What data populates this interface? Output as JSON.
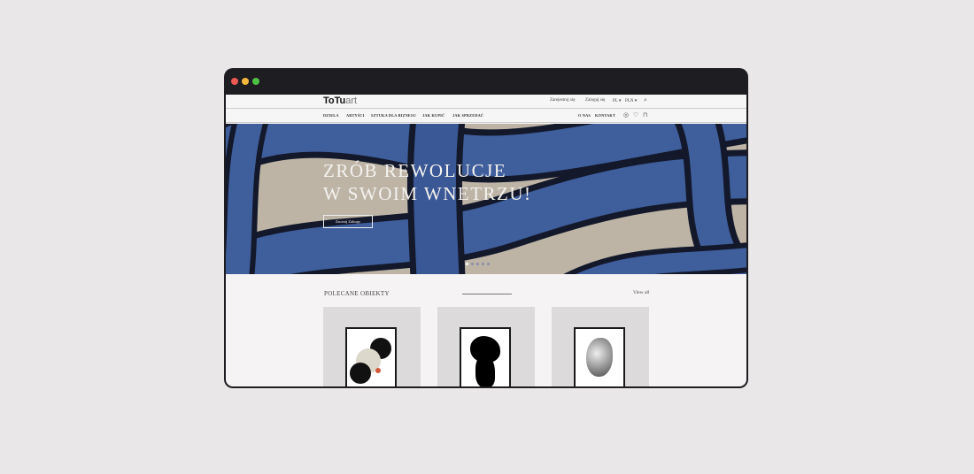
{
  "header": {
    "logo_bold": "ToTu",
    "logo_light": "art",
    "register": "Zarejestruj się",
    "login": "Zaloguj się",
    "language": "PL ▾",
    "currency": "PLN ▾"
  },
  "nav": {
    "items": [
      "DZIEŁA",
      "ARTYŚCI",
      "SZTUKA DLA BIZNESU",
      "JAK KUPIĆ",
      "JAK SPRZEDAĆ"
    ],
    "right": [
      "O NAS",
      "KONTAKT"
    ]
  },
  "hero": {
    "title_line1": "ZRÓB REWOLUCJE",
    "title_line2": "W SWOIM WNETRZU!",
    "button": "Zacznij Zakupy",
    "slides": 5,
    "active_slide": 1
  },
  "featured": {
    "title": "POLECANE OBIEKTY",
    "view_all": "View all"
  },
  "colors": {
    "stroke_blue": "#3f5e9c",
    "stroke_dark": "#13182a",
    "beige": "#bdb4a6"
  }
}
